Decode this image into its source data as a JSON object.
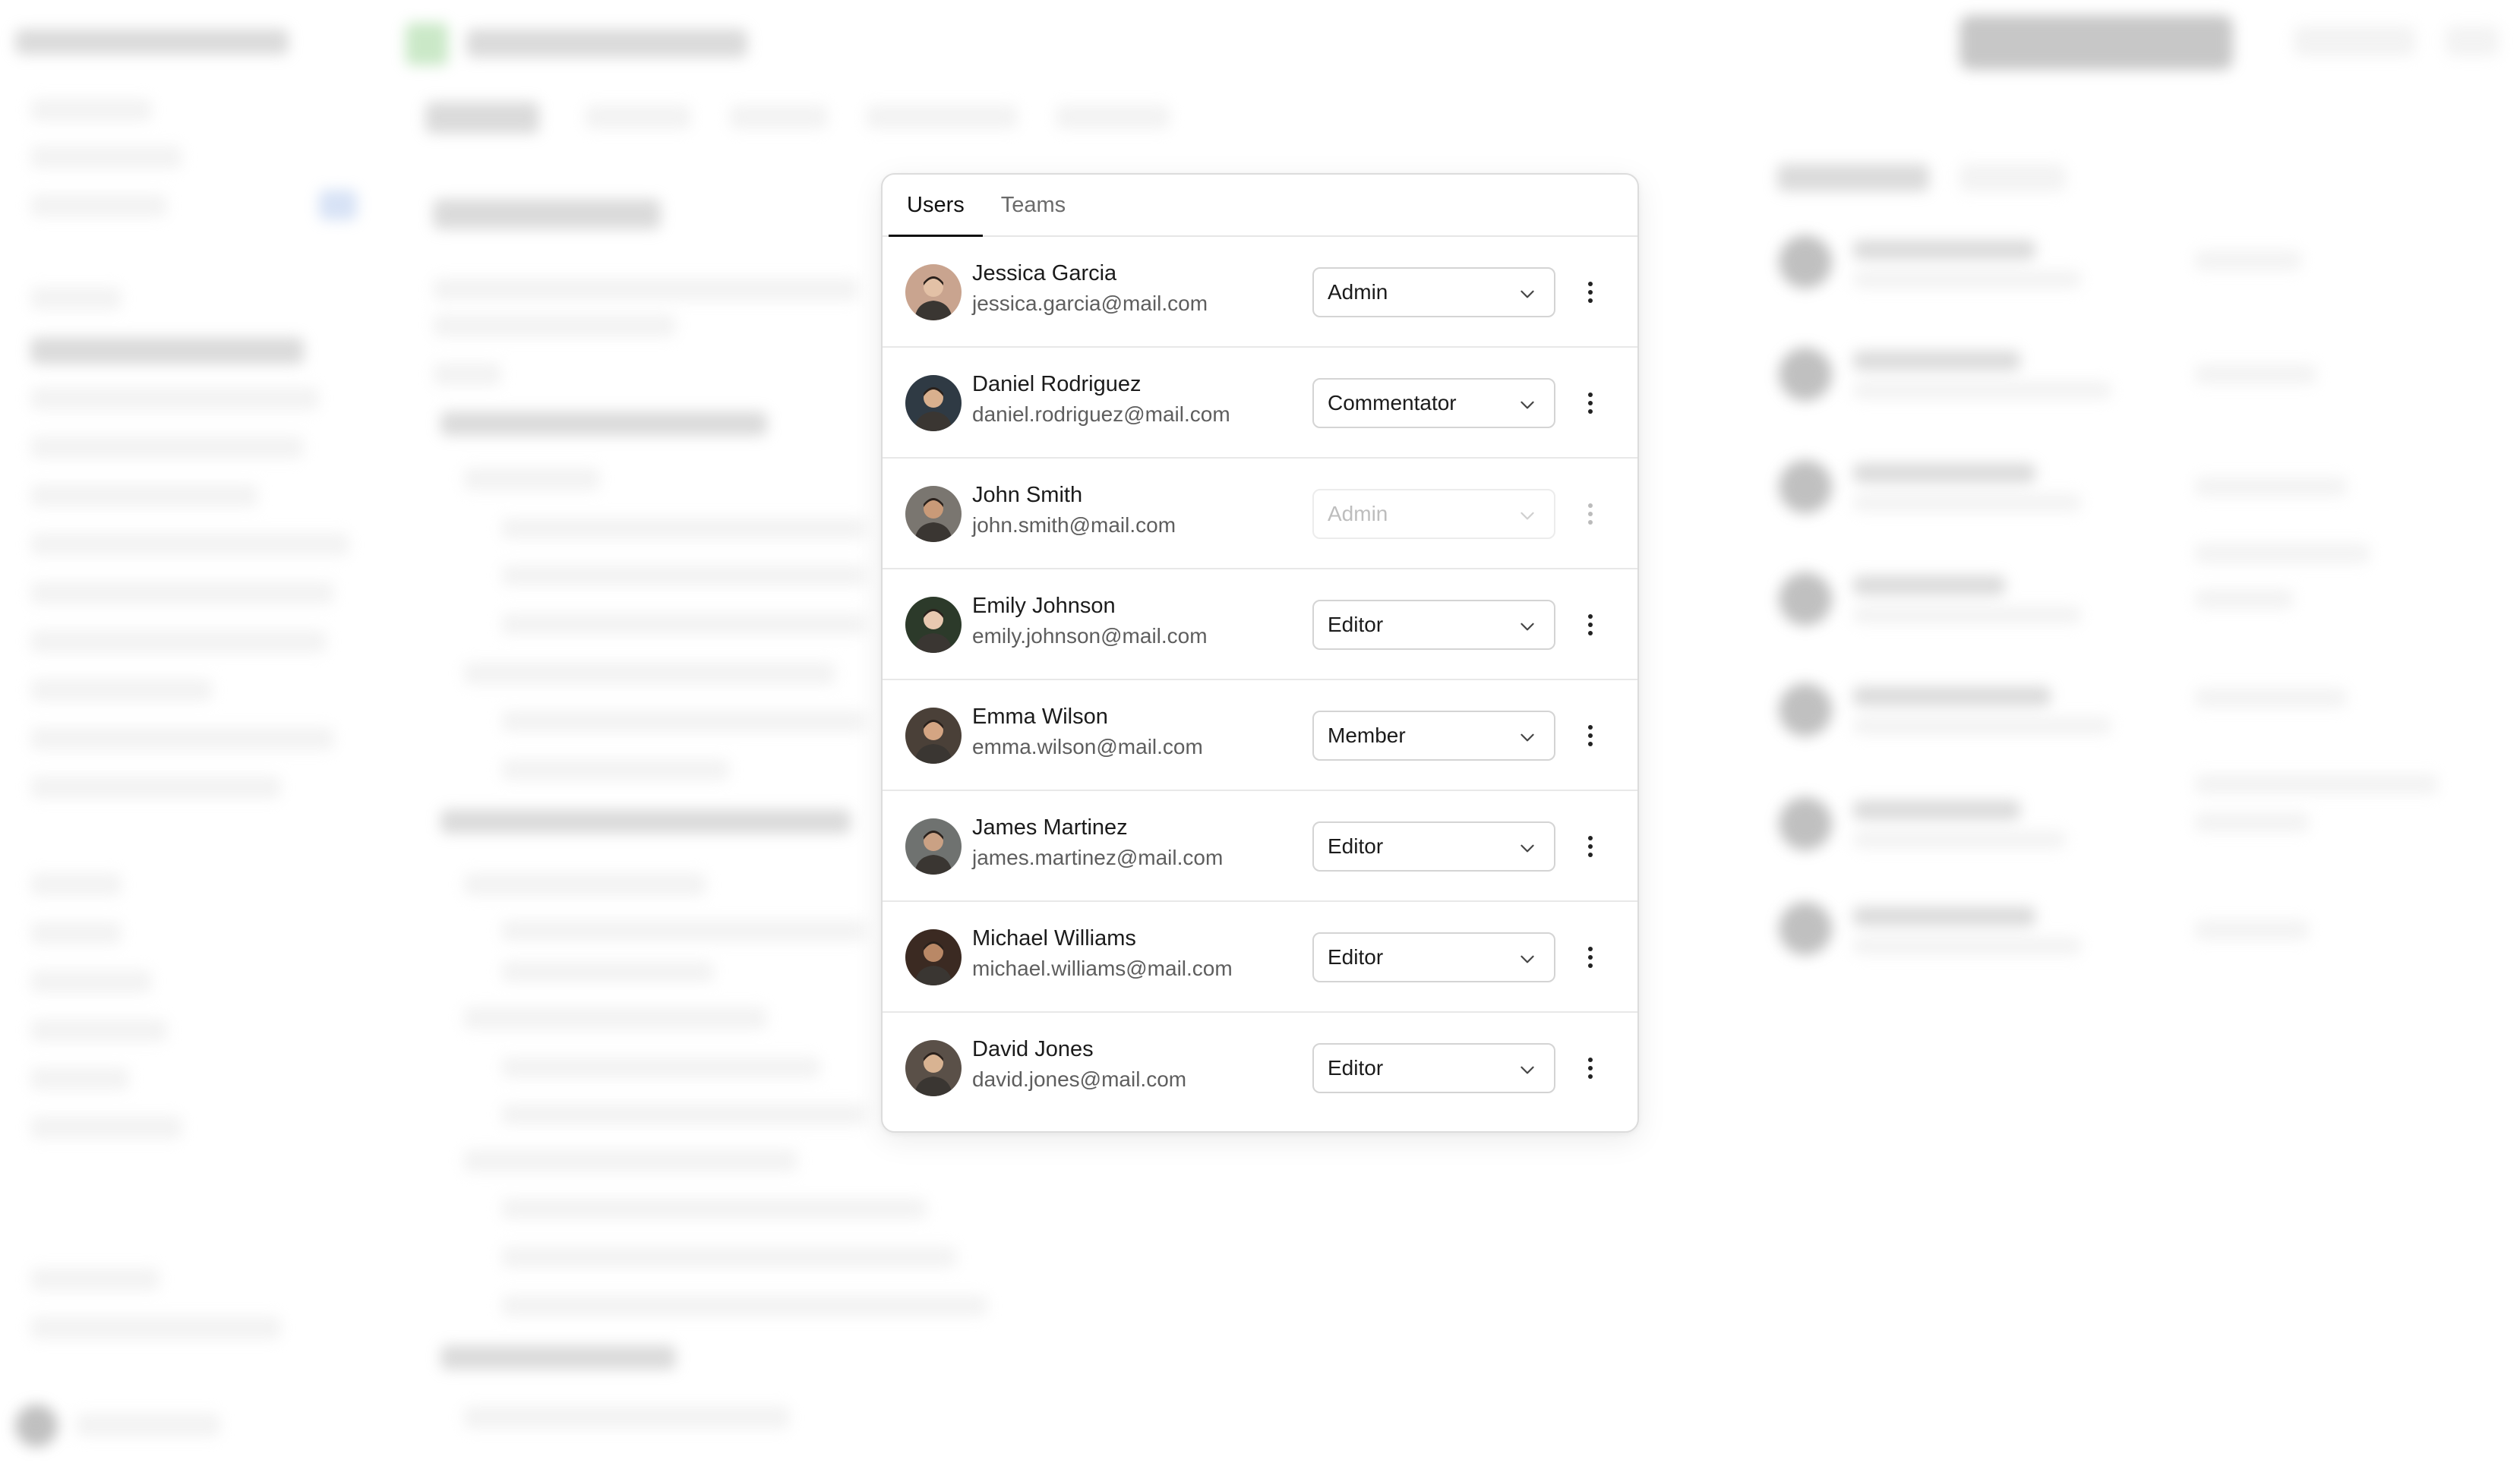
{
  "tabs": [
    {
      "label": "Users",
      "active": true
    },
    {
      "label": "Teams",
      "active": false
    }
  ],
  "users": [
    {
      "name": "Jessica Garcia",
      "email": "jessica.garcia@mail.com",
      "role": "Admin",
      "disabled": false,
      "avatar_color": "#c9a48f"
    },
    {
      "name": "Daniel Rodriguez",
      "email": "daniel.rodriguez@mail.com",
      "role": "Commentator",
      "disabled": false,
      "avatar_color": "#2f3a44"
    },
    {
      "name": "John Smith",
      "email": "john.smith@mail.com",
      "role": "Admin",
      "disabled": true,
      "avatar_color": "#7a7670"
    },
    {
      "name": "Emily Johnson",
      "email": "emily.johnson@mail.com",
      "role": "Editor",
      "disabled": false,
      "avatar_color": "#2c3a2a"
    },
    {
      "name": "Emma Wilson",
      "email": "emma.wilson@mail.com",
      "role": "Member",
      "disabled": false,
      "avatar_color": "#4a4038"
    },
    {
      "name": "James Martinez",
      "email": "james.martinez@mail.com",
      "role": "Editor",
      "disabled": false,
      "avatar_color": "#6f7270"
    },
    {
      "name": "Michael Williams",
      "email": "michael.williams@mail.com",
      "role": "Editor",
      "disabled": false,
      "avatar_color": "#3b2a22"
    },
    {
      "name": "David Jones",
      "email": "david.jones@mail.com",
      "role": "Editor",
      "disabled": false,
      "avatar_color": "#5a5048"
    }
  ],
  "colors": {
    "accent": "#111111",
    "border": "#dcdcdc",
    "muted_text": "#5e5e5e"
  },
  "icons": {
    "select": "chevron-down-icon",
    "row_menu": "more-vertical-icon",
    "avatar": "user-avatar"
  }
}
